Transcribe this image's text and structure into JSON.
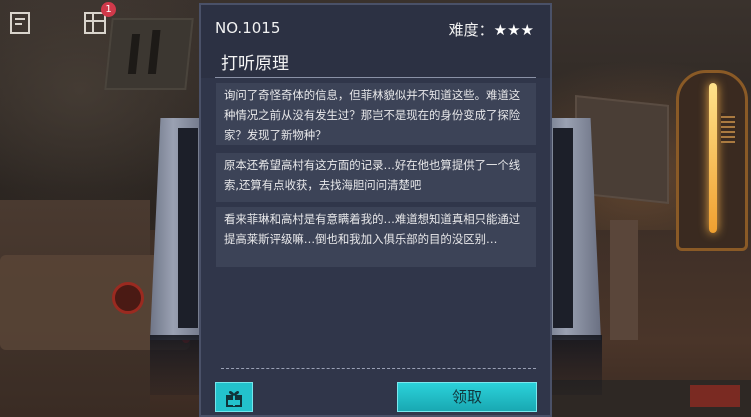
{
  "hud": {
    "notes_icon": "notebook-icon",
    "grid_icon": "grid-menu-icon",
    "badge_count": "1"
  },
  "card": {
    "task_no": "NO.1015",
    "difficulty_label": "难度：",
    "difficulty_stars": "★★★",
    "difficulty_value": 3,
    "title": "打听原理",
    "entries": [
      "询问了奇怪奇体的信息，但菲林貌似并不知道这些。难道这种情况之前从没有发生过？那岂不是现在的身份变成了探险家？发现了新物种？",
      "原本还希望高村有这方面的记录…好在他也算提供了一个线索,还算有点收获，去找海胆问问清楚吧",
      "看来菲琳和高村是有意瞒着我的…难道想知道真相只能通过提高莱斯评级嘛…倒也和我加入俱乐部的目的没区别…"
    ],
    "gift_icon": "gift-icon",
    "claim_label": "领取"
  },
  "colors": {
    "card_bg": "#30364a",
    "entry_bg": "#3c4357",
    "accent_cyan": "#23c2cc",
    "badge_red": "#d0394a"
  }
}
